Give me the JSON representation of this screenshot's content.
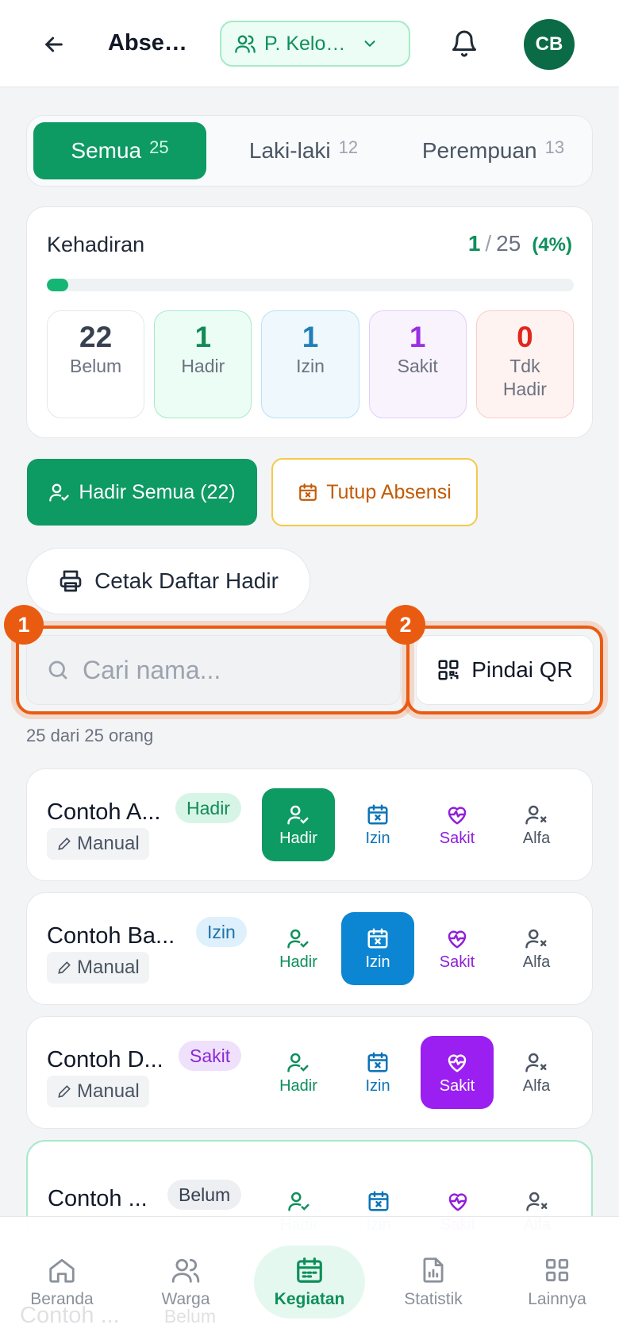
{
  "header": {
    "title": "Absensi",
    "group_label": "P. Kelompok",
    "avatar_initials": "CB"
  },
  "tabs": [
    {
      "label": "Semua",
      "count": "25",
      "active": true
    },
    {
      "label": "Laki-laki",
      "count": "12",
      "active": false
    },
    {
      "label": "Perempuan",
      "count": "13",
      "active": false
    }
  ],
  "attendance": {
    "title": "Kehadiran",
    "present": "1",
    "slash": "/",
    "total": "25",
    "percent": "(4%)",
    "progress_fraction": 0.04,
    "stats": [
      {
        "value": "22",
        "label": "Belum"
      },
      {
        "value": "1",
        "label": "Hadir"
      },
      {
        "value": "1",
        "label": "Izin"
      },
      {
        "value": "1",
        "label": "Sakit"
      },
      {
        "value": "0",
        "label": "Tdk Hadir"
      }
    ]
  },
  "actions": {
    "hadir_semua": "Hadir Semua (22)",
    "tutup_absensi": "Tutup Absensi",
    "cetak": "Cetak Daftar Hadir"
  },
  "search": {
    "placeholder": "Cari nama...",
    "qr_label": "Pindai QR",
    "highlight_1": "1",
    "highlight_2": "2"
  },
  "count_text": "25 dari 25 orang",
  "action_labels": {
    "hadir": "Hadir",
    "izin": "Izin",
    "sakit": "Sakit",
    "alfa": "Alfa"
  },
  "members": [
    {
      "name": "Contoh A...",
      "status": "Hadir",
      "source": "Manual"
    },
    {
      "name": "Contoh Ba...",
      "status": "Izin",
      "source": "Manual"
    },
    {
      "name": "Contoh D...",
      "status": "Sakit",
      "source": "Manual"
    },
    {
      "name": "Contoh ...",
      "status": "Belum",
      "source": ""
    }
  ],
  "ghost_member": {
    "name": "Contoh ...",
    "status": "Belum"
  },
  "nav": [
    {
      "label": "Beranda",
      "icon": "home-icon"
    },
    {
      "label": "Warga",
      "icon": "users-icon"
    },
    {
      "label": "Kegiatan",
      "icon": "calendar-icon",
      "active": true
    },
    {
      "label": "Statistik",
      "icon": "chart-file-icon"
    },
    {
      "label": "Lainnya",
      "icon": "grid-icon"
    }
  ],
  "colors": {
    "primary": "#0e9a63",
    "highlight": "#ea5b12",
    "izin": "#0c86d2",
    "sakit": "#9a1ff0",
    "tdk_hadir": "#e0281c",
    "tutup": "#c25b05"
  }
}
